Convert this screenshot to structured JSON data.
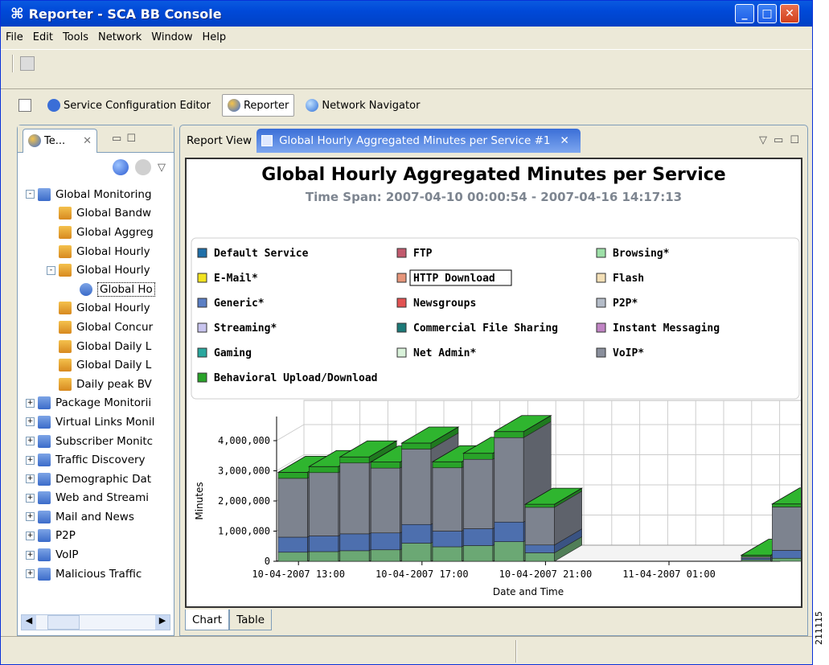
{
  "window": {
    "title": "Reporter - SCA BB Console"
  },
  "menu": [
    "File",
    "Edit",
    "Tools",
    "Network",
    "Window",
    "Help"
  ],
  "perspectives": [
    {
      "label": "Service Configuration Editor",
      "active": false
    },
    {
      "label": "Reporter",
      "active": true
    },
    {
      "label": "Network Navigator",
      "active": false
    }
  ],
  "left_view": {
    "tab_label": "Te...",
    "tree": [
      {
        "label": "Global Monitoring",
        "level": 0,
        "expander": "-",
        "icon": "group"
      },
      {
        "label": "Global Bandw",
        "level": 1,
        "expander": "",
        "icon": "report"
      },
      {
        "label": "Global Aggreg",
        "level": 1,
        "expander": "",
        "icon": "report"
      },
      {
        "label": "Global Hourly",
        "level": 1,
        "expander": "",
        "icon": "report"
      },
      {
        "label": "Global Hourly",
        "level": 1,
        "expander": "-",
        "icon": "report"
      },
      {
        "label": "Global Ho",
        "level": 2,
        "expander": "",
        "icon": "instance",
        "selected": true
      },
      {
        "label": "Global Hourly",
        "level": 1,
        "expander": "",
        "icon": "report"
      },
      {
        "label": "Global Concur",
        "level": 1,
        "expander": "",
        "icon": "report"
      },
      {
        "label": "Global Daily L",
        "level": 1,
        "expander": "",
        "icon": "report"
      },
      {
        "label": "Global Daily L",
        "level": 1,
        "expander": "",
        "icon": "report"
      },
      {
        "label": "Daily peak BV",
        "level": 1,
        "expander": "",
        "icon": "report"
      },
      {
        "label": "Package Monitorii",
        "level": 0,
        "expander": "+",
        "icon": "group"
      },
      {
        "label": "Virtual Links Monil",
        "level": 0,
        "expander": "+",
        "icon": "group"
      },
      {
        "label": "Subscriber Monitc",
        "level": 0,
        "expander": "+",
        "icon": "group"
      },
      {
        "label": "Traffic Discovery",
        "level": 0,
        "expander": "+",
        "icon": "group"
      },
      {
        "label": "Demographic Dat",
        "level": 0,
        "expander": "+",
        "icon": "group"
      },
      {
        "label": "Web and Streami",
        "level": 0,
        "expander": "+",
        "icon": "group"
      },
      {
        "label": "Mail and News",
        "level": 0,
        "expander": "+",
        "icon": "group"
      },
      {
        "label": "P2P",
        "level": 0,
        "expander": "+",
        "icon": "group"
      },
      {
        "label": "VoIP",
        "level": 0,
        "expander": "+",
        "icon": "group"
      },
      {
        "label": "Malicious Traffic",
        "level": 0,
        "expander": "+",
        "icon": "group"
      }
    ]
  },
  "report_view": {
    "tab_report_view": "Report View",
    "tab_active": "Global Hourly Aggregated Minutes per Service #1",
    "bottom_tabs": [
      "Chart",
      "Table"
    ],
    "active_bottom_tab": "Chart"
  },
  "figure_number": "211115",
  "chart_data": {
    "type": "bar",
    "stacked": true,
    "three_d": true,
    "title": "Global Hourly Aggregated Minutes per Service",
    "subtitle": "Time Span: 2007-04-10 00:00:54 - 2007-04-16 14:17:13",
    "xlabel": "Date and Time",
    "ylabel": "Minutes",
    "ylim": [
      0,
      4800000
    ],
    "yticks": [
      "0",
      "1,000,000",
      "2,000,000",
      "3,000,000",
      "4,000,000"
    ],
    "xticks": [
      "10-04-2007 13:00",
      "10-04-2007 17:00",
      "10-04-2007 21:00",
      "11-04-2007 01:00"
    ],
    "legend": [
      {
        "name": "Default Service",
        "color": "#1f6fa8"
      },
      {
        "name": "FTP",
        "color": "#c25a6e"
      },
      {
        "name": "Browsing*",
        "color": "#9ee0a8"
      },
      {
        "name": "E-Mail*",
        "color": "#f2e320"
      },
      {
        "name": "HTTP Download",
        "color": "#e6957a"
      },
      {
        "name": "Flash",
        "color": "#f3dfb6"
      },
      {
        "name": "Generic*",
        "color": "#5b7fc4"
      },
      {
        "name": "Newsgroups",
        "color": "#e25252"
      },
      {
        "name": "P2P*",
        "color": "#b4bcc8"
      },
      {
        "name": "Streaming*",
        "color": "#c8c4ee"
      },
      {
        "name": "Commercial File Sharing",
        "color": "#1c7a78"
      },
      {
        "name": "Instant Messaging",
        "color": "#c084c4"
      },
      {
        "name": "Gaming",
        "color": "#2aa79e"
      },
      {
        "name": "Net Admin*",
        "color": "#d9f2da"
      },
      {
        "name": "VoIP*",
        "color": "#8a8f9c"
      },
      {
        "name": "Behavioral Upload/Download",
        "color": "#29a329"
      }
    ],
    "series": [
      {
        "name": "Browsing*",
        "values": [
          300000,
          320000,
          350000,
          380000,
          600000,
          480000,
          520000,
          650000,
          280000,
          0,
          0,
          0,
          0,
          0,
          0,
          50000,
          100000
        ]
      },
      {
        "name": "Generic*",
        "values": [
          500000,
          520000,
          560000,
          560000,
          620000,
          520000,
          560000,
          650000,
          260000,
          0,
          0,
          0,
          0,
          0,
          0,
          50000,
          260000
        ]
      },
      {
        "name": "VoIP*",
        "values": [
          1950000,
          2100000,
          2350000,
          2150000,
          2500000,
          2100000,
          2300000,
          2800000,
          1250000,
          0,
          0,
          0,
          0,
          0,
          0,
          50000,
          1440000
        ]
      },
      {
        "name": "Behavioral Upload/Download",
        "values": [
          200000,
          200000,
          200000,
          200000,
          200000,
          200000,
          200000,
          200000,
          100000,
          0,
          0,
          0,
          0,
          0,
          0,
          50000,
          100000
        ]
      }
    ]
  }
}
